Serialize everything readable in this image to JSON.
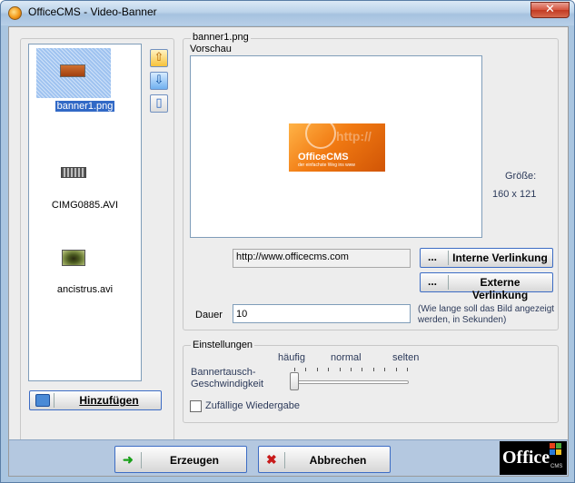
{
  "window": {
    "title": "OfficeCMS - Video-Banner",
    "close_symbol": "✕"
  },
  "files": {
    "items": [
      {
        "label": "banner1.png",
        "selected": true,
        "thumb": "banner-thumb"
      },
      {
        "label": "CIMG0885.AVI",
        "selected": false,
        "thumb": "video-thumb"
      },
      {
        "label": "ancistrus.avi",
        "selected": false,
        "thumb": "fish-thumb"
      }
    ],
    "add_label": "Hinzufügen",
    "up_icon": "⇧",
    "down_icon": "⇩",
    "props_icon": "▯"
  },
  "preview": {
    "group_title": "banner1.png",
    "label": "Vorschau",
    "banner_title": "OfficeCMS",
    "banner_sub": "der einfachste Weg ins www",
    "banner_ghost": "http://",
    "size_label": "Größe:",
    "size_value": "160 x 121"
  },
  "link": {
    "url": "http://www.officecms.com",
    "dots": "...",
    "internal_label": "Interne Verlinkung",
    "external_label": "Externe Verlinkung"
  },
  "duration": {
    "label": "Dauer",
    "value": "10",
    "hint": "(Wie lange soll das Bild angezeigt werden, in Sekunden)"
  },
  "settings": {
    "title": "Einstellungen",
    "tick_often": "häufig",
    "tick_normal": "normal",
    "tick_rare": "selten",
    "speed_label_1": "Bannertausch-",
    "speed_label_2": "Geschwindigkeit",
    "speed_level": 0,
    "random_label": "Zufällige Wiedergabe",
    "random_checked": false
  },
  "buttons": {
    "create_label": "Erzeugen",
    "cancel_label": "Abbrechen",
    "create_icon": "➜",
    "cancel_icon": "✖"
  },
  "logo": {
    "main": "Office",
    "sub": "CMS"
  },
  "colors": {
    "accent": "#3169c6",
    "bottom_bar": "#b4c8e0",
    "banner_orange": "#f17a12"
  }
}
